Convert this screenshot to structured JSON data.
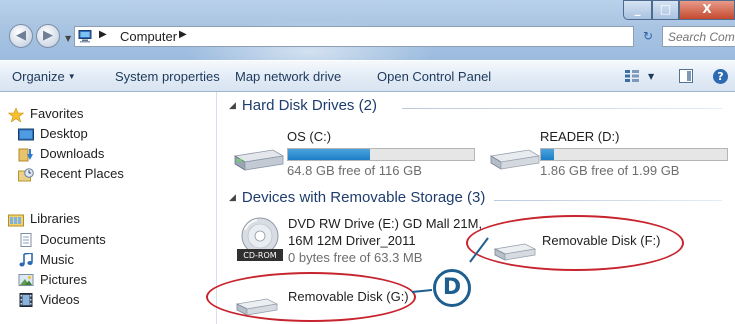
{
  "window": {
    "address": {
      "path_segments": [
        "Computer"
      ],
      "icon": "computer-icon"
    },
    "search": {
      "placeholder": "Search Com..."
    },
    "controls": [
      "minimize",
      "maximize",
      "close"
    ]
  },
  "toolbar": {
    "organize_label": "Organize",
    "system_properties_label": "System properties",
    "map_network_drive_label": "Map network drive",
    "open_control_panel_label": "Open Control Panel"
  },
  "nav": {
    "favorites": {
      "label": "Favorites",
      "items": [
        {
          "label": "Desktop",
          "icon": "desktop-icon"
        },
        {
          "label": "Downloads",
          "icon": "downloads-icon"
        },
        {
          "label": "Recent Places",
          "icon": "recent-places-icon"
        }
      ]
    },
    "libraries": {
      "label": "Libraries",
      "items": [
        {
          "label": "Documents",
          "icon": "documents-icon"
        },
        {
          "label": "Music",
          "icon": "music-icon"
        },
        {
          "label": "Pictures",
          "icon": "pictures-icon"
        },
        {
          "label": "Videos",
          "icon": "videos-icon"
        }
      ]
    }
  },
  "content": {
    "hard_disk_group": {
      "label": "Hard Disk Drives (2)",
      "drives": [
        {
          "name": "OS (C:)",
          "free": "64.8 GB free of 116 GB",
          "used_fraction": 0.44
        },
        {
          "name": "READER (D:)",
          "free": "1.86 GB free of 1.99 GB",
          "used_fraction": 0.07
        }
      ]
    },
    "removable_group": {
      "label": "Devices with Removable Storage (3)",
      "dvd": {
        "name_line1": "DVD RW Drive (E:) GD Mall 21M,",
        "name_line2": "16M 12M Driver_2011",
        "free": "0 bytes free of 63.3 MB",
        "badge": "CD-ROM"
      },
      "removable_f": {
        "name": "Removable Disk (F:)"
      },
      "removable_g": {
        "name": "Removable Disk (G:)"
      }
    }
  },
  "callout": {
    "label": "D",
    "color": "#c8242e",
    "badge_color": "#1f5f8f"
  }
}
